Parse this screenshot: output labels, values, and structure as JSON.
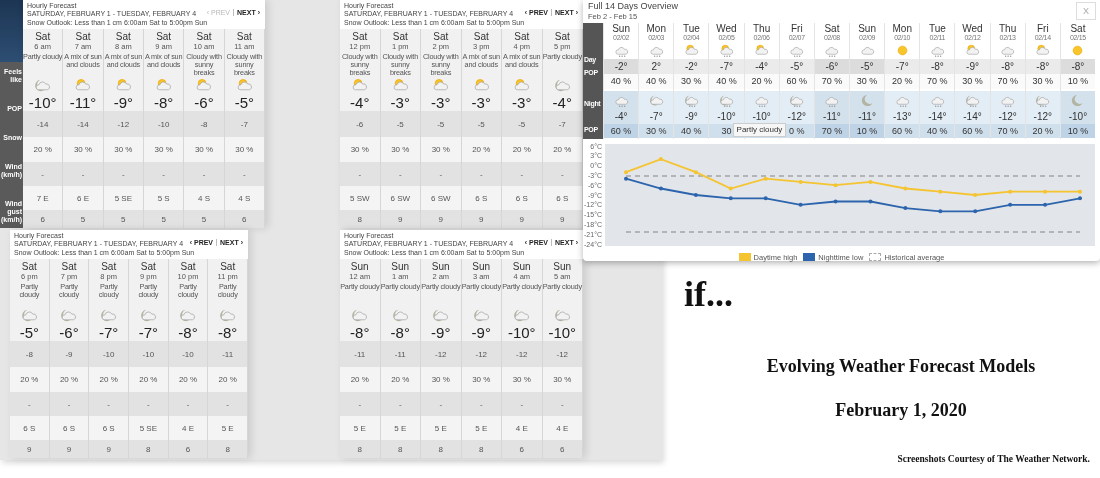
{
  "hourly_panels": [
    {
      "title": "Hourly Forecast",
      "date_range": "SATURDAY, FEBRUARY 1 - TUESDAY, FEBRUARY 4",
      "snow_outlook": "Snow Outlook: Less than 1 cm 6:00am Sat to 5:00pm Sun",
      "prev": "‹ PREV",
      "next": "NEXT ›",
      "prev_disabled": true,
      "row_labels": [
        "Feels like",
        "POP",
        "Snow",
        "Wind (km/h)",
        "Wind gust (km/h)"
      ],
      "hours": [
        {
          "day": "Sat",
          "time": "6 am",
          "condition": "Partly cloudy",
          "kind": "moon_cloud",
          "temp": "-10°",
          "feels": "-14",
          "pop": "20 %",
          "snow": "-",
          "wind": "7 E",
          "gust": "6"
        },
        {
          "day": "Sat",
          "time": "7 am",
          "condition": "A mix of sun and clouds",
          "kind": "sun_cloud",
          "temp": "-11°",
          "feels": "-14",
          "pop": "30 %",
          "snow": "-",
          "wind": "6 E",
          "gust": "5"
        },
        {
          "day": "Sat",
          "time": "8 am",
          "condition": "A mix of sun and clouds",
          "kind": "sun_cloud",
          "temp": "-9°",
          "feels": "-12",
          "pop": "30 %",
          "snow": "-",
          "wind": "5 SE",
          "gust": "5"
        },
        {
          "day": "Sat",
          "time": "9 am",
          "condition": "A mix of sun and clouds",
          "kind": "sun_cloud",
          "temp": "-8°",
          "feels": "-10",
          "pop": "30 %",
          "snow": "-",
          "wind": "5 S",
          "gust": "5"
        },
        {
          "day": "Sat",
          "time": "10 am",
          "condition": "Cloudy with sunny breaks",
          "kind": "sun_cloud",
          "temp": "-6°",
          "feels": "-8",
          "pop": "30 %",
          "snow": "-",
          "wind": "4 S",
          "gust": "5"
        },
        {
          "day": "Sat",
          "time": "11 am",
          "condition": "Cloudy with sunny breaks",
          "kind": "sun_cloud",
          "temp": "-5°",
          "feels": "-7",
          "pop": "30 %",
          "snow": "-",
          "wind": "4 S",
          "gust": "6"
        }
      ]
    },
    {
      "title": "Hourly Forecast",
      "date_range": "SATURDAY, FEBRUARY 1 - TUESDAY, FEBRUARY 4",
      "snow_outlook": "Snow Outlook: Less than 1 cm 6:00am Sat to 5:00pm Sun",
      "prev": "‹ PREV",
      "next": "NEXT ›",
      "prev_disabled": false,
      "hours": [
        {
          "day": "Sat",
          "time": "12 pm",
          "condition": "Cloudy with sunny breaks",
          "kind": "sun_cloud",
          "temp": "-4°",
          "feels": "-6",
          "pop": "30 %",
          "snow": "-",
          "wind": "5 SW",
          "gust": "8"
        },
        {
          "day": "Sat",
          "time": "1 pm",
          "condition": "Cloudy with sunny breaks",
          "kind": "sun_cloud",
          "temp": "-3°",
          "feels": "-5",
          "pop": "30 %",
          "snow": "-",
          "wind": "6 SW",
          "gust": "9"
        },
        {
          "day": "Sat",
          "time": "2 pm",
          "condition": "Cloudy with sunny breaks",
          "kind": "sun_cloud",
          "temp": "-3°",
          "feels": "-5",
          "pop": "30 %",
          "snow": "-",
          "wind": "6 SW",
          "gust": "9"
        },
        {
          "day": "Sat",
          "time": "3 pm",
          "condition": "A mix of sun and clouds",
          "kind": "sun_cloud",
          "temp": "-3°",
          "feels": "-5",
          "pop": "20 %",
          "snow": "-",
          "wind": "6 S",
          "gust": "9"
        },
        {
          "day": "Sat",
          "time": "4 pm",
          "condition": "A mix of sun and clouds",
          "kind": "sun_cloud",
          "temp": "-3°",
          "feels": "-5",
          "pop": "20 %",
          "snow": "-",
          "wind": "6 S",
          "gust": "9"
        },
        {
          "day": "Sat",
          "time": "5 pm",
          "condition": "Partly cloudy",
          "kind": "moon_cloud",
          "temp": "-4°",
          "feels": "-7",
          "pop": "20 %",
          "snow": "-",
          "wind": "6 S",
          "gust": "9"
        }
      ]
    },
    {
      "title": "Hourly Forecast",
      "date_range": "SATURDAY, FEBRUARY 1 - TUESDAY, FEBRUARY 4",
      "snow_outlook": "Snow Outlook: Less than 1 cm 6:00am Sat to 5:00pm Sun",
      "prev": "‹ PREV",
      "next": "NEXT ›",
      "prev_disabled": false,
      "hours": [
        {
          "day": "Sat",
          "time": "6 pm",
          "condition": "Partly cloudy",
          "kind": "moon_cloud",
          "temp": "-5°",
          "feels": "-8",
          "pop": "20 %",
          "snow": "-",
          "wind": "6 S",
          "gust": "9"
        },
        {
          "day": "Sat",
          "time": "7 pm",
          "condition": "Partly cloudy",
          "kind": "moon_cloud",
          "temp": "-6°",
          "feels": "-9",
          "pop": "20 %",
          "snow": "-",
          "wind": "6 S",
          "gust": "9"
        },
        {
          "day": "Sat",
          "time": "8 pm",
          "condition": "Partly cloudy",
          "kind": "moon_cloud",
          "temp": "-7°",
          "feels": "-10",
          "pop": "20 %",
          "snow": "-",
          "wind": "6 S",
          "gust": "9"
        },
        {
          "day": "Sat",
          "time": "9 pm",
          "condition": "Partly cloudy",
          "kind": "moon_cloud",
          "temp": "-7°",
          "feels": "-10",
          "pop": "20 %",
          "snow": "-",
          "wind": "5 SE",
          "gust": "8"
        },
        {
          "day": "Sat",
          "time": "10 pm",
          "condition": "Partly cloudy",
          "kind": "moon_cloud",
          "temp": "-8°",
          "feels": "-10",
          "pop": "20 %",
          "snow": "-",
          "wind": "4 E",
          "gust": "6"
        },
        {
          "day": "Sat",
          "time": "11 pm",
          "condition": "Partly cloudy",
          "kind": "moon_cloud",
          "temp": "-8°",
          "feels": "-11",
          "pop": "20 %",
          "snow": "-",
          "wind": "5 E",
          "gust": "8"
        }
      ]
    },
    {
      "title": "Hourly Forecast",
      "date_range": "SATURDAY, FEBRUARY 1 - TUESDAY, FEBRUARY 4",
      "snow_outlook": "Snow Outlook: Less than 1 cm 6:00am Sat to 5:00pm Sun",
      "prev": "‹ PREV",
      "next": "NEXT ›",
      "prev_disabled": false,
      "hours": [
        {
          "day": "Sun",
          "time": "12 am",
          "condition": "Partly cloudy",
          "kind": "moon_cloud",
          "temp": "-8°",
          "feels": "-11",
          "pop": "20 %",
          "snow": "-",
          "wind": "5 E",
          "gust": "8"
        },
        {
          "day": "Sun",
          "time": "1 am",
          "condition": "Partly cloudy",
          "kind": "moon_cloud",
          "temp": "-8°",
          "feels": "-11",
          "pop": "20 %",
          "snow": "-",
          "wind": "5 E",
          "gust": "8"
        },
        {
          "day": "Sun",
          "time": "2 am",
          "condition": "Partly cloudy",
          "kind": "moon_cloud",
          "temp": "-9°",
          "feels": "-12",
          "pop": "30 %",
          "snow": "-",
          "wind": "5 E",
          "gust": "8"
        },
        {
          "day": "Sun",
          "time": "3 am",
          "condition": "Partly cloudy",
          "kind": "moon_cloud",
          "temp": "-9°",
          "feels": "-12",
          "pop": "30 %",
          "snow": "-",
          "wind": "5 E",
          "gust": "8"
        },
        {
          "day": "Sun",
          "time": "4 am",
          "condition": "Partly cloudy",
          "kind": "moon_cloud",
          "temp": "-10°",
          "feels": "-12",
          "pop": "30 %",
          "snow": "-",
          "wind": "4 E",
          "gust": "6"
        },
        {
          "day": "Sun",
          "time": "5 am",
          "condition": "Partly cloudy",
          "kind": "moon_cloud",
          "temp": "-10°",
          "feels": "-12",
          "pop": "30 %",
          "snow": "-",
          "wind": "4 E",
          "gust": "6"
        }
      ]
    }
  ],
  "overview": {
    "title": "Full 14 Days Overview",
    "subtitle": "Feb 2 - Feb 15",
    "close": "X",
    "row_labels": [
      "Day",
      "POP",
      "Night",
      "POP"
    ],
    "days": [
      {
        "day": "Sun",
        "date": "02/02",
        "weekend": true,
        "daytime": {
          "kind": "snow",
          "temp": "-2°",
          "pop": "40 %"
        },
        "night": {
          "kind": "snow",
          "temp": "-4°",
          "pop": "60 %"
        }
      },
      {
        "day": "Mon",
        "date": "02/03",
        "weekend": false,
        "daytime": {
          "kind": "snow",
          "temp": "2°",
          "pop": "40 %"
        },
        "night": {
          "kind": "moon_cloud",
          "temp": "-7°",
          "pop": "30 %"
        }
      },
      {
        "day": "Tue",
        "date": "02/04",
        "weekend": false,
        "daytime": {
          "kind": "sun_cloud",
          "temp": "-2°",
          "pop": "30 %"
        },
        "night": {
          "kind": "moon_cloud_snow",
          "temp": "-9°",
          "pop": "40 %"
        }
      },
      {
        "day": "Wed",
        "date": "02/05",
        "weekend": false,
        "daytime": {
          "kind": "sun_cloud_snow",
          "temp": "-7°",
          "pop": "40 %"
        },
        "night": {
          "kind": "moon_cloud_snow",
          "temp": "-10°",
          "pop": "30"
        }
      },
      {
        "day": "Thu",
        "date": "02/06",
        "weekend": false,
        "daytime": {
          "kind": "sun_cloud",
          "temp": "-4°",
          "pop": "20 %"
        },
        "night": {
          "kind": "snow",
          "temp": "-10°",
          "tooltip": "Partly cloudy"
        }
      },
      {
        "day": "Fri",
        "date": "02/07",
        "weekend": false,
        "daytime": {
          "kind": "snow",
          "temp": "-5°",
          "pop": "60 %"
        },
        "night": {
          "kind": "moon_cloud_snow",
          "temp": "-12°",
          "pop": "0 %"
        }
      },
      {
        "day": "Sat",
        "date": "02/08",
        "weekend": true,
        "daytime": {
          "kind": "snow",
          "temp": "-6°",
          "pop": "70 %"
        },
        "night": {
          "kind": "snow",
          "temp": "-11°",
          "pop": "70 %"
        }
      },
      {
        "day": "Sun",
        "date": "02/09",
        "weekend": true,
        "daytime": {
          "kind": "cloud",
          "temp": "-5°",
          "pop": "30 %"
        },
        "night": {
          "kind": "moon",
          "temp": "-11°",
          "pop": "10 %"
        }
      },
      {
        "day": "Mon",
        "date": "02/10",
        "weekend": false,
        "daytime": {
          "kind": "sun",
          "temp": "-7°",
          "pop": "20 %"
        },
        "night": {
          "kind": "snow",
          "temp": "-13°",
          "pop": "60 %"
        }
      },
      {
        "day": "Tue",
        "date": "02/11",
        "weekend": false,
        "daytime": {
          "kind": "snow",
          "temp": "-8°",
          "pop": "70 %"
        },
        "night": {
          "kind": "snow",
          "temp": "-14°",
          "pop": "40 %"
        }
      },
      {
        "day": "Wed",
        "date": "02/12",
        "weekend": false,
        "daytime": {
          "kind": "sun_cloud",
          "temp": "-9°",
          "pop": "30 %"
        },
        "night": {
          "kind": "moon_cloud_snow",
          "temp": "-14°",
          "pop": "60 %"
        }
      },
      {
        "day": "Thu",
        "date": "02/13",
        "weekend": false,
        "daytime": {
          "kind": "snow",
          "temp": "-8°",
          "pop": "70 %"
        },
        "night": {
          "kind": "snow",
          "temp": "-12°",
          "pop": "70 %"
        }
      },
      {
        "day": "Fri",
        "date": "02/14",
        "weekend": false,
        "daytime": {
          "kind": "sun_cloud",
          "temp": "-8°",
          "pop": "30 %"
        },
        "night": {
          "kind": "moon_cloud_snow",
          "temp": "-12°",
          "pop": "20 %"
        }
      },
      {
        "day": "Sat",
        "date": "02/15",
        "weekend": true,
        "daytime": {
          "kind": "sun",
          "temp": "-8°",
          "pop": "10 %"
        },
        "night": {
          "kind": "moon",
          "temp": "-10°",
          "pop": "10 %"
        }
      }
    ],
    "chart_data": {
      "type": "line",
      "series": [
        {
          "name": "Daytime high",
          "color": "#f5c431",
          "values": [
            -2,
            2,
            -2,
            -7,
            -4,
            -5,
            -6,
            -5,
            -7,
            -8,
            -9,
            -8,
            -8,
            -8
          ]
        },
        {
          "name": "Nighttime low",
          "color": "#2c64ad",
          "values": [
            -4,
            -7,
            -9,
            -10,
            -10,
            -12,
            -11,
            -11,
            -13,
            -14,
            -14,
            -12,
            -12,
            -10
          ]
        }
      ],
      "ylim": [
        -24,
        6
      ],
      "yticks": [
        {
          "value": 6,
          "label": "6°C"
        },
        {
          "value": 3,
          "label": "3°C"
        },
        {
          "value": 0,
          "label": "0°C"
        },
        {
          "value": -3,
          "label": "-3°C"
        },
        {
          "value": -6,
          "label": "-6°C"
        },
        {
          "value": -9,
          "label": "-9°C"
        },
        {
          "value": -12,
          "label": "-12°C"
        },
        {
          "value": -15,
          "label": "-15°C"
        },
        {
          "value": -18,
          "label": "-18°C"
        },
        {
          "value": -21,
          "label": "-21°C"
        },
        {
          "value": -24,
          "label": "-24°C"
        }
      ],
      "legend": "bottom"
    },
    "average_label": "Historical average"
  },
  "slide": {
    "lead": "if...",
    "title": "Evolving Weather Forecast Models",
    "date": "February 1, 2020",
    "credit": "Screenshots Courtesy of The Weather Network."
  }
}
